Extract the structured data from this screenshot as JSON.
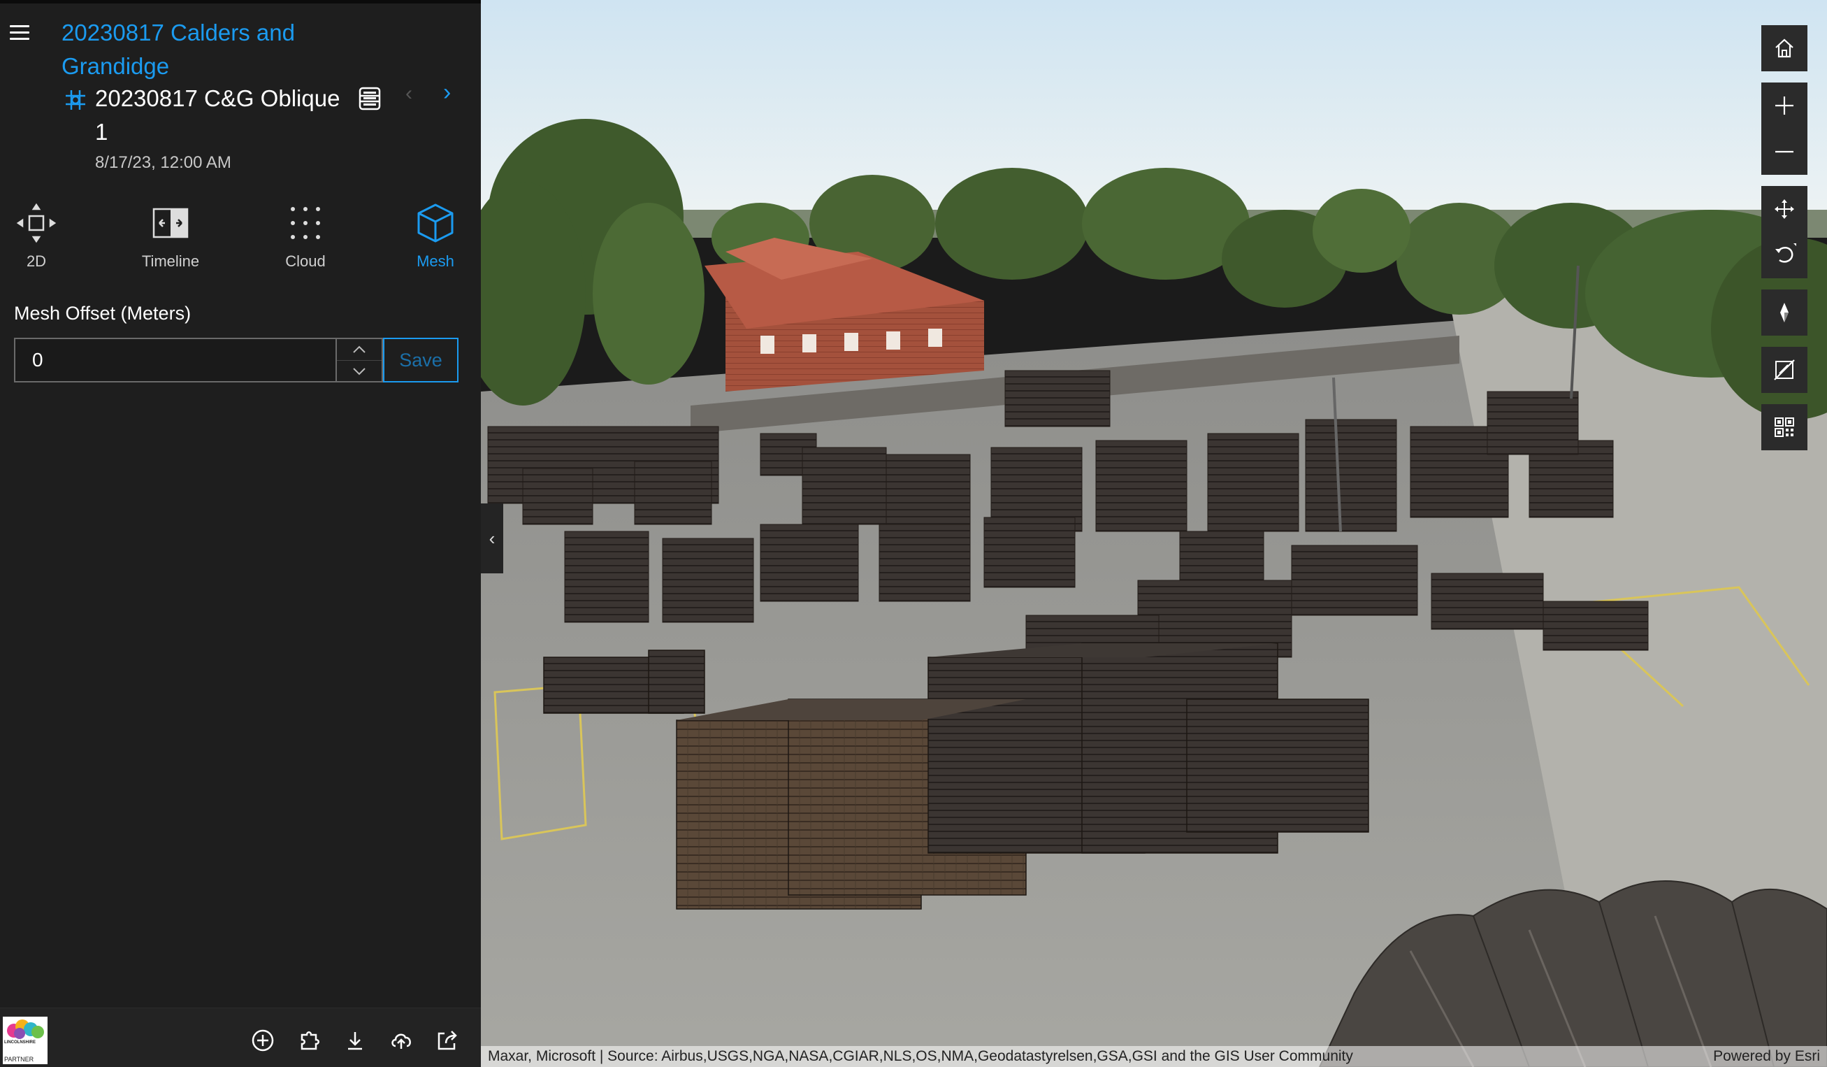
{
  "panel": {
    "title": "20230817 Calders and Grandidge",
    "layer_name": "20230817 C&G Oblique",
    "layer_name_suffix": "1",
    "date": "8/17/23, 12:00 AM",
    "prev_label": "‹",
    "next_label": "›",
    "collapse_label": "‹"
  },
  "view_modes": [
    {
      "label": "2D",
      "icon": "move-2d-icon",
      "active": false
    },
    {
      "label": "Timeline",
      "icon": "timeline-icon",
      "active": false
    },
    {
      "label": "Cloud",
      "icon": "point-cloud-icon",
      "active": false
    },
    {
      "label": "Mesh",
      "icon": "mesh-cube-icon",
      "active": true
    }
  ],
  "mesh_offset": {
    "label": "Mesh Offset (Meters)",
    "value": "0",
    "save_label": "Save"
  },
  "bottom_toolbar": [
    "add-circle-icon",
    "puzzle-icon",
    "download-icon",
    "upload-cloud-icon",
    "share-icon"
  ],
  "partner_logo": {
    "text": "LINCOLNSHIRE",
    "partner": "PARTNER"
  },
  "map_tools": [
    "home-icon",
    "zoom-in-icon",
    "zoom-out-icon",
    "pan-icon",
    "rotate-icon",
    "compass-icon",
    "no-daylight-icon",
    "qr-grid-icon"
  ],
  "attribution": "Maxar, Microsoft | Source: Airbus,USGS,NGA,NASA,CGIAR,NLS,OS,NMA,Geodatastyrelsen,GSA,GSI and the GIS User Community",
  "powered_by": "Powered by Esri",
  "colors": {
    "accent": "#1b9bf0",
    "panel_bg": "#1e1e1e",
    "button_bg": "#2b2b2b"
  }
}
